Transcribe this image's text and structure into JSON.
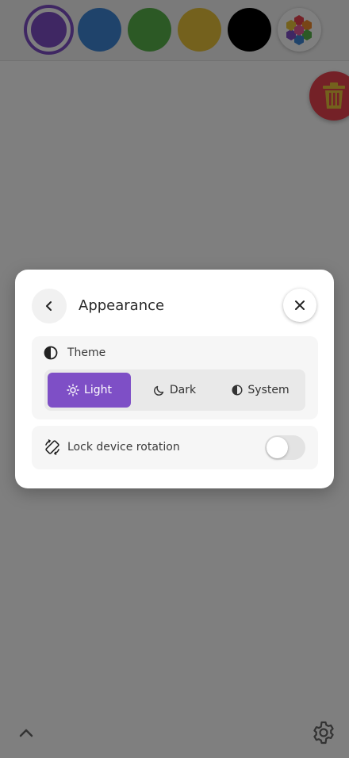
{
  "colors": {
    "swatches": [
      {
        "name": "purple",
        "hex": "#7e4fc6",
        "selected": true
      },
      {
        "name": "blue",
        "hex": "#3f87d6",
        "selected": false
      },
      {
        "name": "green",
        "hex": "#58b34a",
        "selected": false
      },
      {
        "name": "yellow",
        "hex": "#e9c23a",
        "selected": false
      },
      {
        "name": "black",
        "hex": "#000000",
        "selected": false
      }
    ],
    "accent": "#7e4fc6",
    "trash": "#e8434f"
  },
  "icons": {
    "palette": "hexagon-palette-icon",
    "trash": "trash-icon",
    "chevron_up": "chevron-up-icon",
    "settings": "gear-icon",
    "back": "chevron-left-icon",
    "close": "close-icon",
    "theme": "contrast-icon",
    "light": "sun-icon",
    "dark": "moon-icon",
    "system": "contrast-icon",
    "rotation": "rotate-device-icon"
  },
  "modal": {
    "title": "Appearance",
    "theme": {
      "label": "Theme",
      "options": [
        "Light",
        "Dark",
        "System"
      ],
      "selected": "Light"
    },
    "rotation": {
      "label": "Lock device rotation",
      "enabled": false
    }
  }
}
